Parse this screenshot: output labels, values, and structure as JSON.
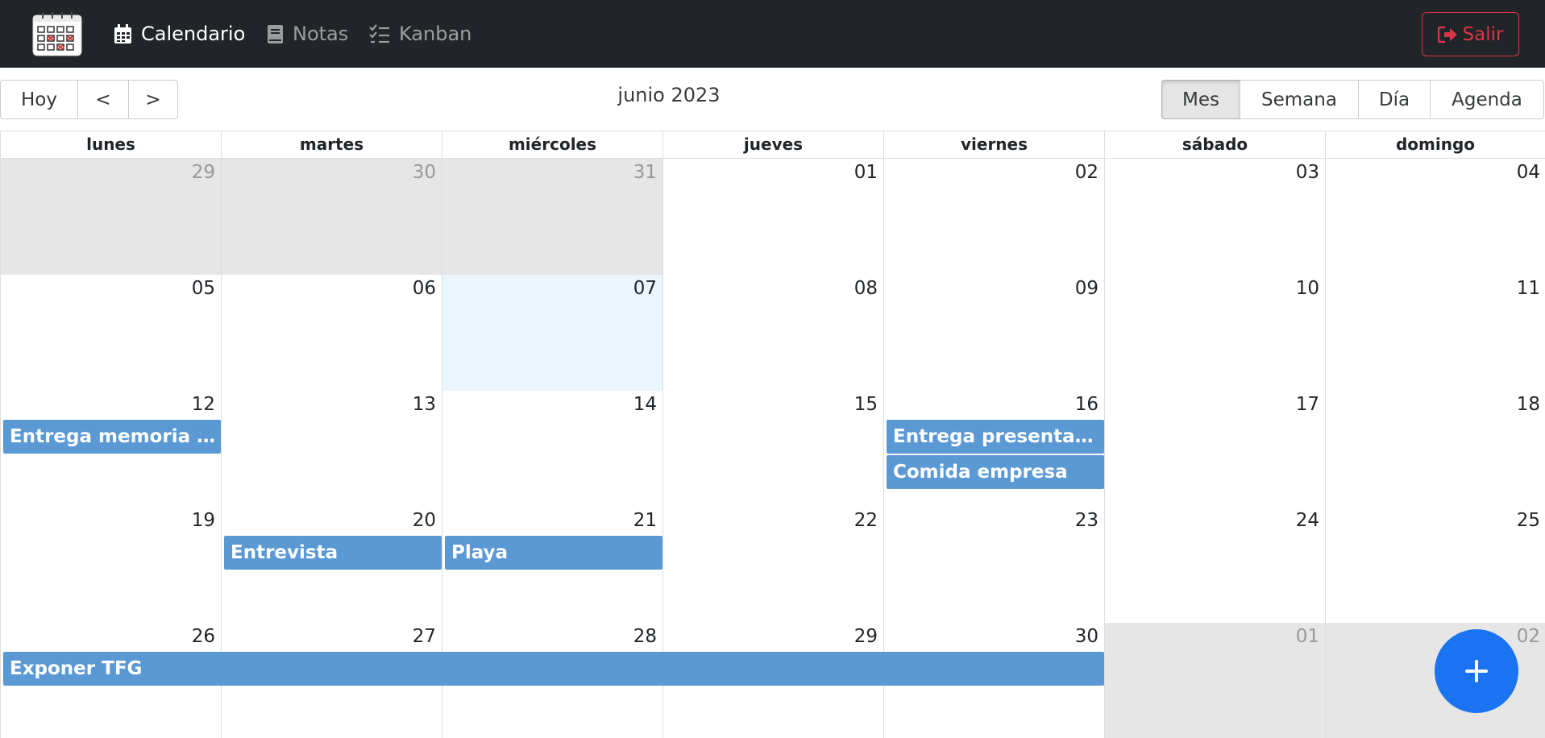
{
  "nav": {
    "links": [
      {
        "label": "Calendario",
        "icon": "calendar-icon",
        "active": true
      },
      {
        "label": "Notas",
        "icon": "book-icon",
        "active": false
      },
      {
        "label": "Kanban",
        "icon": "checklist-icon",
        "active": false
      }
    ],
    "logout_label": "Salir"
  },
  "toolbar": {
    "today": "Hoy",
    "prev": "<",
    "next": ">",
    "label": "junio 2023",
    "views": [
      "Mes",
      "Semana",
      "Día",
      "Agenda"
    ],
    "active_view": "Mes"
  },
  "calendar": {
    "weekdays": [
      "lunes",
      "martes",
      "miércoles",
      "jueves",
      "viernes",
      "sábado",
      "domingo"
    ],
    "weeks": [
      [
        "29",
        "30",
        "31",
        "01",
        "02",
        "03",
        "04"
      ],
      [
        "05",
        "06",
        "07",
        "08",
        "09",
        "10",
        "11"
      ],
      [
        "12",
        "13",
        "14",
        "15",
        "16",
        "17",
        "18"
      ],
      [
        "19",
        "20",
        "21",
        "22",
        "23",
        "24",
        "25"
      ],
      [
        "26",
        "27",
        "28",
        "29",
        "30",
        "01",
        "02"
      ]
    ],
    "events": [
      "Entrega memoria TFG",
      "Entrega presentación",
      "Comida empresa",
      "Entrevista",
      "Playa",
      "Exponer TFG"
    ]
  },
  "colors": {
    "navbar": "#212529",
    "event": "#5b99d5",
    "today": "#eaf6ff",
    "off_range": "#e6e6e6",
    "fab": "#1a73f0",
    "logout": "#dc3545"
  },
  "fab_icon": "plus-icon"
}
